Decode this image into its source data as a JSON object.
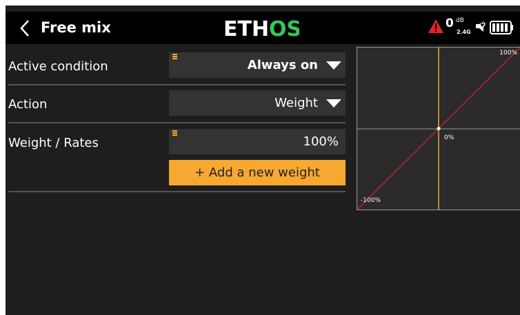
{
  "header": {
    "title": "Free mix",
    "logo": "ETHOS",
    "status": {
      "rssi_value": "0",
      "rssi_unit": "dB",
      "band": "2.4G",
      "icons": [
        "warning-icon",
        "speaker-icon",
        "battery-icon"
      ]
    }
  },
  "rows": {
    "active_condition": {
      "label": "Active condition",
      "value": "Always on"
    },
    "action": {
      "label": "Action",
      "value": "Weight"
    },
    "weight": {
      "label": "Weight / Rates",
      "value": "100%"
    },
    "add_button": "+ Add a new weight"
  },
  "graph": {
    "top_right_label": "100%",
    "center_label": "0%",
    "bottom_left_label": "-100%",
    "curve": {
      "x": [
        -100,
        100
      ],
      "y": [
        -100,
        100
      ]
    },
    "cursor_x": 0
  },
  "colors": {
    "accent": "#f7a830",
    "curve": "#e02020",
    "warning": "#e82020",
    "field_bg": "#333333",
    "screen_bg": "#1e1e1e"
  }
}
